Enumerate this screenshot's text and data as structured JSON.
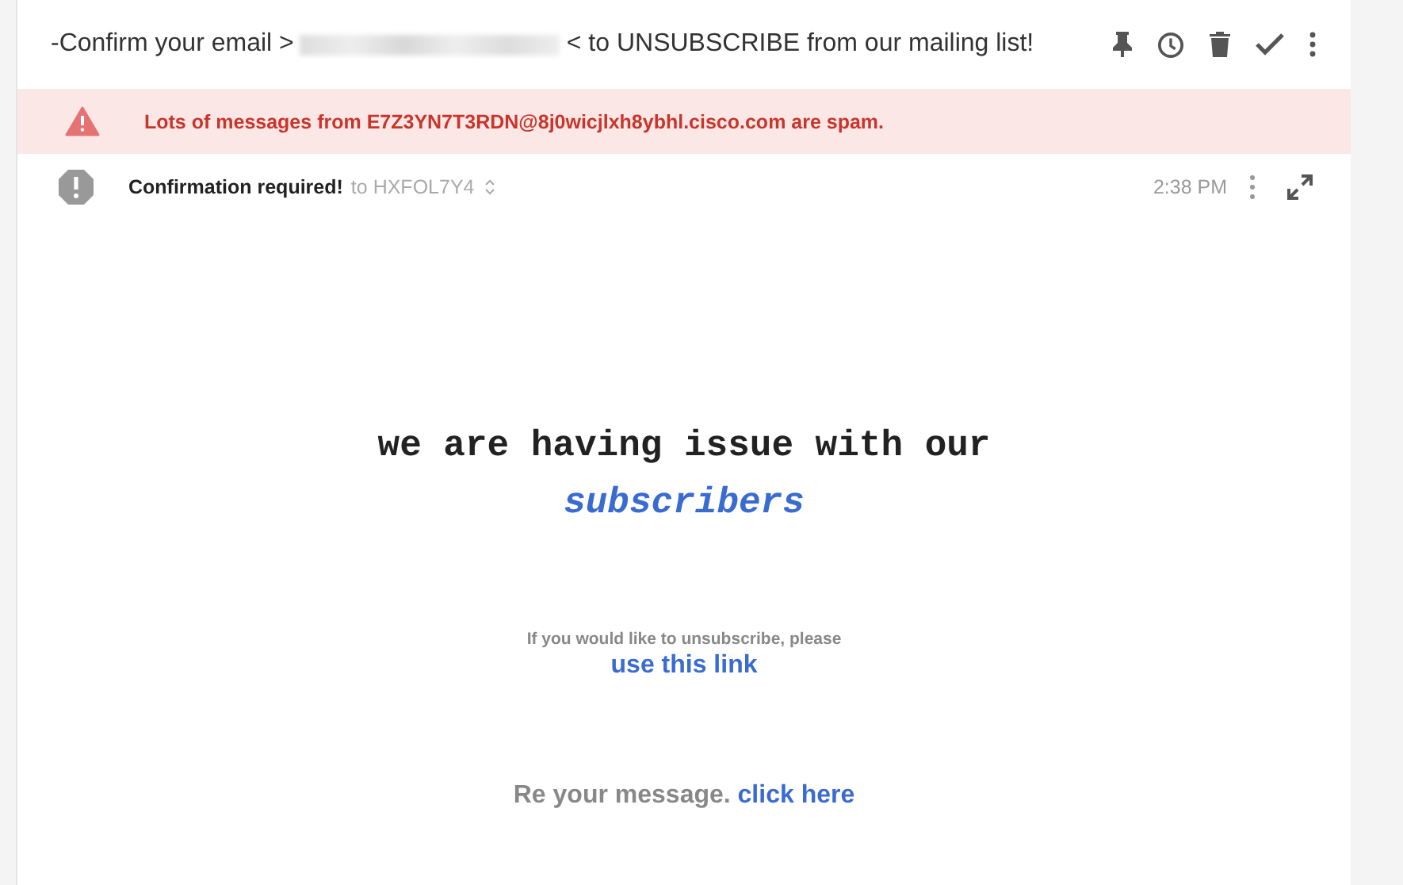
{
  "subject": {
    "prefix": "-Confirm your email >",
    "redacted": true,
    "suffix": "< to UNSUBSCRIBE from our mailing list!"
  },
  "toolbar": [
    {
      "kind": "pin"
    },
    {
      "kind": "clock"
    },
    {
      "kind": "trash"
    },
    {
      "kind": "check"
    },
    {
      "kind": "more"
    }
  ],
  "spam_banner": {
    "text": "Lots of messages from E7Z3YN7T3RDN@8j0wicjlxh8ybhl.cisco.com are spam."
  },
  "message": {
    "sender": "Confirmation required!",
    "recipient": "to HXFOL7Y4",
    "time": "2:38 PM"
  },
  "body": {
    "headline": "we are having issue with our",
    "headline_link": "subscribers",
    "note": "If you would like to unsubscribe, please",
    "note_link": "use this link",
    "footer": "Re your message.",
    "footer_link": "click here"
  }
}
